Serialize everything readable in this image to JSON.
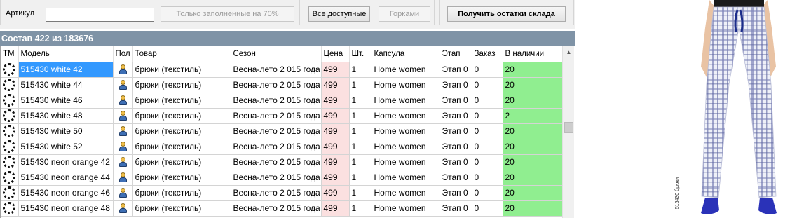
{
  "toolbar": {
    "article_label": "Артикул",
    "article_value": "",
    "filled_btn": "Только заполненные на 70%",
    "all_btn": "Все доступные",
    "hills_btn": "Горками",
    "stock_btn": "Получить остатки склада"
  },
  "grid": {
    "header": "Состав 422 из 183676",
    "columns": [
      "ТМ",
      "Модель",
      "Пол",
      "Товар",
      "Сезон",
      "Цена",
      "Шт.",
      "Капсула",
      "Этап",
      "Заказ",
      "В наличии"
    ],
    "rows": [
      {
        "model": "515430 white  42",
        "product": "брюки (текстиль)",
        "season": "Весна-лето 2 015 года",
        "price": "499",
        "qty": "1",
        "capsule": "Home women",
        "stage": "Этап 0",
        "order": "0",
        "stock": "20"
      },
      {
        "model": "515430 white  44",
        "product": "брюки (текстиль)",
        "season": "Весна-лето 2 015 года",
        "price": "499",
        "qty": "1",
        "capsule": "Home women",
        "stage": "Этап 0",
        "order": "0",
        "stock": "20"
      },
      {
        "model": "515430 white  46",
        "product": "брюки (текстиль)",
        "season": "Весна-лето 2 015 года",
        "price": "499",
        "qty": "1",
        "capsule": "Home women",
        "stage": "Этап 0",
        "order": "0",
        "stock": "20"
      },
      {
        "model": "515430 white  48",
        "product": "брюки (текстиль)",
        "season": "Весна-лето 2 015 года",
        "price": "499",
        "qty": "1",
        "capsule": "Home women",
        "stage": "Этап 0",
        "order": "0",
        "stock": "2"
      },
      {
        "model": "515430 white  50",
        "product": "брюки (текстиль)",
        "season": "Весна-лето 2 015 года",
        "price": "499",
        "qty": "1",
        "capsule": "Home women",
        "stage": "Этап 0",
        "order": "0",
        "stock": "20"
      },
      {
        "model": "515430 white  52",
        "product": "брюки (текстиль)",
        "season": "Весна-лето 2 015 года",
        "price": "499",
        "qty": "1",
        "capsule": "Home women",
        "stage": "Этап 0",
        "order": "0",
        "stock": "20"
      },
      {
        "model": "515430 neon orange  42",
        "product": "брюки (текстиль)",
        "season": "Весна-лето 2 015 года",
        "price": "499",
        "qty": "1",
        "capsule": "Home women",
        "stage": "Этап 0",
        "order": "0",
        "stock": "20"
      },
      {
        "model": "515430 neon orange  44",
        "product": "брюки (текстиль)",
        "season": "Весна-лето 2 015 года",
        "price": "499",
        "qty": "1",
        "capsule": "Home women",
        "stage": "Этап 0",
        "order": "0",
        "stock": "20"
      },
      {
        "model": "515430 neon orange  46",
        "product": "брюки (текстиль)",
        "season": "Весна-лето 2 015 года",
        "price": "499",
        "qty": "1",
        "capsule": "Home women",
        "stage": "Этап 0",
        "order": "0",
        "stock": "20"
      },
      {
        "model": "515430 neon orange  48",
        "product": "брюки (текстиль)",
        "season": "Весна-лето 2 015 года",
        "price": "499",
        "qty": "1",
        "capsule": "Home women",
        "stage": "Этап 0",
        "order": "0",
        "stock": "20"
      }
    ]
  },
  "product_image": {
    "caption": "515430 брюки"
  },
  "colors": {
    "header_bar": "#7f93a6",
    "selected": "#3399ff",
    "price_bg": "#fbe0e0",
    "stock_bg": "#90ee90"
  }
}
